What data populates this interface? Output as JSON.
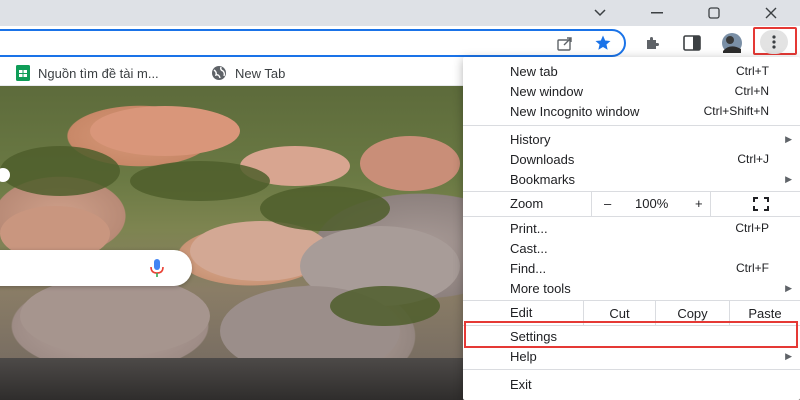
{
  "bookmarks": [
    {
      "label": "Nguồn tìm đề tài m...",
      "icon": "google-sheets-icon"
    },
    {
      "label": "New Tab",
      "icon": "globe-icon"
    }
  ],
  "menu": {
    "new_tab": {
      "label": "New tab",
      "shortcut": "Ctrl+T"
    },
    "new_window": {
      "label": "New window",
      "shortcut": "Ctrl+N"
    },
    "new_incognito": {
      "label": "New Incognito window",
      "shortcut": "Ctrl+Shift+N"
    },
    "history": {
      "label": "History"
    },
    "downloads": {
      "label": "Downloads",
      "shortcut": "Ctrl+J"
    },
    "bookmarks": {
      "label": "Bookmarks"
    },
    "zoom": {
      "label": "Zoom",
      "minus": "–",
      "value": "100%",
      "plus": "+"
    },
    "print": {
      "label": "Print...",
      "shortcut": "Ctrl+P"
    },
    "cast": {
      "label": "Cast..."
    },
    "find": {
      "label": "Find...",
      "shortcut": "Ctrl+F"
    },
    "more_tools": {
      "label": "More tools"
    },
    "edit": {
      "label": "Edit",
      "cut": "Cut",
      "copy": "Copy",
      "paste": "Paste"
    },
    "settings": {
      "label": "Settings"
    },
    "help": {
      "label": "Help"
    },
    "exit": {
      "label": "Exit"
    }
  },
  "colors": {
    "accent": "#1a73e8",
    "highlight_box": "#e53935",
    "titlebar": "#dee1e6"
  }
}
